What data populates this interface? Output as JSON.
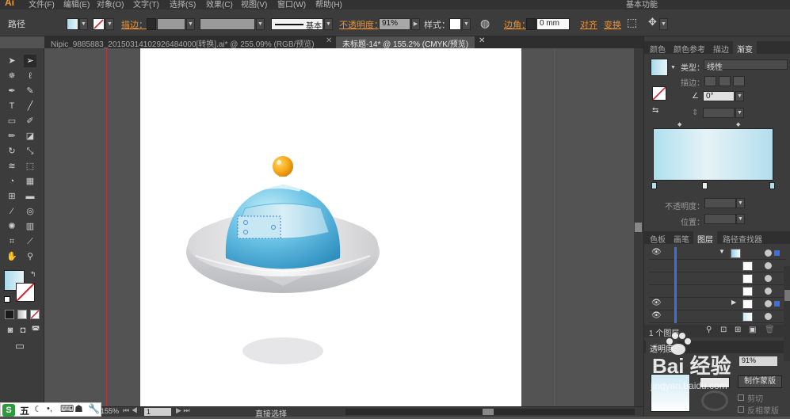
{
  "menubar": {
    "logo": "Ai",
    "items": [
      "文件(F)",
      "编辑(E)",
      "对象(O)",
      "文字(T)",
      "选择(S)",
      "效果(C)",
      "视图(V)",
      "窗口(W)",
      "帮助(H)"
    ],
    "workspace": "基本功能"
  },
  "control_bar": {
    "selection_type": "路径",
    "stroke_label": "描边：",
    "stroke_profile": "基本",
    "opacity_label": "不透明度：",
    "opacity_value": "91%",
    "style_label": "样式：",
    "corner_label": "边角：",
    "corner_value": "0 mm",
    "align_label": "对齐",
    "transform_label": "变换"
  },
  "document_tabs": [
    {
      "label": "Nipic_9885883_20150314102926484000[转换].ai* @ 255.09% (RGB/预览)",
      "active": false
    },
    {
      "label": "未标题-14* @ 155.2% (CMYK/预览)",
      "active": true
    }
  ],
  "status_bar": {
    "zoom": "155%",
    "page": "1",
    "tool_name": "直接选择"
  },
  "panels": {
    "top_tabs": [
      "颜色",
      "颜色参考",
      "描边",
      "渐变"
    ],
    "gradient": {
      "type_label": "类型：",
      "type_value": "线性",
      "stroke_label": "描边：",
      "angle_value": "0°",
      "opacity_label": "不透明度：",
      "position_label": "位置：",
      "start_color": "#aee0ef",
      "mid_color": "#e6f3f6",
      "end_color": "#b3deee"
    },
    "layers_tabs": [
      "色板",
      "画笔",
      "图层",
      "路径查找器"
    ],
    "layers_count": "1 个图层",
    "transparency_tab": "透明度",
    "transparency_opacity": "91%",
    "make_mask_label": "制作蒙版",
    "clip_label": "剪切",
    "invert_mask_label": "反相蒙版"
  },
  "watermark": {
    "text": "Bai 经验",
    "url": "jingyan.baidu.com"
  },
  "taskbar": {
    "ime_logo": "S",
    "ime_label": "五"
  },
  "colors": {
    "ui_dark": "#3c3c3c",
    "canvas_bg": "#535353",
    "accent_orange": "#e8923a",
    "guide_red": "#b8333a"
  }
}
